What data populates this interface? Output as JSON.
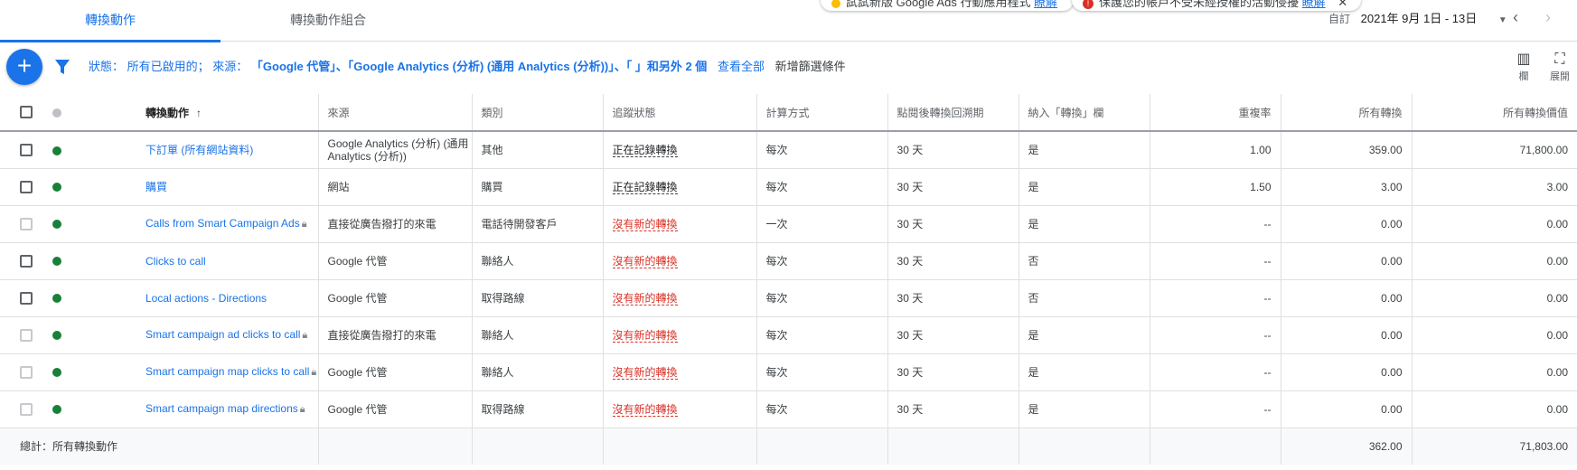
{
  "tabs": [
    {
      "label": "轉換動作"
    },
    {
      "label": "轉換動作組合"
    }
  ],
  "notices": [
    {
      "text": "試試新版 Google Ads 行動應用程式",
      "link": "瞭解"
    },
    {
      "text": "保護您的帳戶不受未經授權的活動侵擾",
      "link": "瞭解"
    }
  ],
  "date": {
    "label": "自訂",
    "range": "2021年 9月 1日 - 13日"
  },
  "filter": {
    "status_label": "狀態：",
    "status_value": "所有已啟用的；",
    "source_label": "來源：",
    "source_value": "「Google 代管」、「Google Analytics (分析) (通用 Analytics (分析))」、「 」和另外 2 個",
    "view_all": "查看全部",
    "add_filter": "新增篩選條件"
  },
  "tools": {
    "columns": "欄",
    "expand": "展開"
  },
  "table": {
    "headers": [
      "轉換動作",
      "來源",
      "類別",
      "追蹤狀態",
      "計算方式",
      "點閱後轉換回溯期",
      "納入「轉換」欄",
      "重複率",
      "所有轉換",
      "所有轉換價值"
    ],
    "rows": [
      {
        "name": "下訂單 (所有網站資料)",
        "locked": false,
        "source": "Google Analytics (分析) (通用 Analytics (分析))",
        "category": "其他",
        "status": "正在記錄轉換",
        "status_ok": true,
        "count": "每次",
        "window": "30 天",
        "include": "是",
        "dup": "1.00",
        "conv": "359.00",
        "value": "71,800.00"
      },
      {
        "name": "購買",
        "locked": false,
        "source": "網站",
        "category": "購買",
        "status": "正在記錄轉換",
        "status_ok": true,
        "count": "每次",
        "window": "30 天",
        "include": "是",
        "dup": "1.50",
        "conv": "3.00",
        "value": "3.00"
      },
      {
        "name": "Calls from Smart Campaign Ads",
        "locked": true,
        "source": "直接從廣告撥打的來電",
        "category": "電話待開發客戶",
        "status": "沒有新的轉換",
        "status_ok": false,
        "count": "一次",
        "window": "30 天",
        "include": "是",
        "dup": "--",
        "conv": "0.00",
        "value": "0.00"
      },
      {
        "name": "Clicks to call",
        "locked": false,
        "source": "Google 代管",
        "category": "聯絡人",
        "status": "沒有新的轉換",
        "status_ok": false,
        "count": "每次",
        "window": "30 天",
        "include": "否",
        "dup": "--",
        "conv": "0.00",
        "value": "0.00"
      },
      {
        "name": "Local actions - Directions",
        "locked": false,
        "source": "Google 代管",
        "category": "取得路線",
        "status": "沒有新的轉換",
        "status_ok": false,
        "count": "每次",
        "window": "30 天",
        "include": "否",
        "dup": "--",
        "conv": "0.00",
        "value": "0.00"
      },
      {
        "name": "Smart campaign ad clicks to call",
        "locked": true,
        "source": "直接從廣告撥打的來電",
        "category": "聯絡人",
        "status": "沒有新的轉換",
        "status_ok": false,
        "count": "每次",
        "window": "30 天",
        "include": "是",
        "dup": "--",
        "conv": "0.00",
        "value": "0.00"
      },
      {
        "name": "Smart campaign map clicks to call",
        "locked": true,
        "source": "Google 代管",
        "category": "聯絡人",
        "status": "沒有新的轉換",
        "status_ok": false,
        "count": "每次",
        "window": "30 天",
        "include": "是",
        "dup": "--",
        "conv": "0.00",
        "value": "0.00"
      },
      {
        "name": "Smart campaign map directions",
        "locked": true,
        "source": "Google 代管",
        "category": "取得路線",
        "status": "沒有新的轉換",
        "status_ok": false,
        "count": "每次",
        "window": "30 天",
        "include": "是",
        "dup": "--",
        "conv": "0.00",
        "value": "0.00"
      }
    ],
    "total": {
      "label": "總計：所有轉換動作",
      "conv": "362.00",
      "value": "71,803.00"
    }
  }
}
